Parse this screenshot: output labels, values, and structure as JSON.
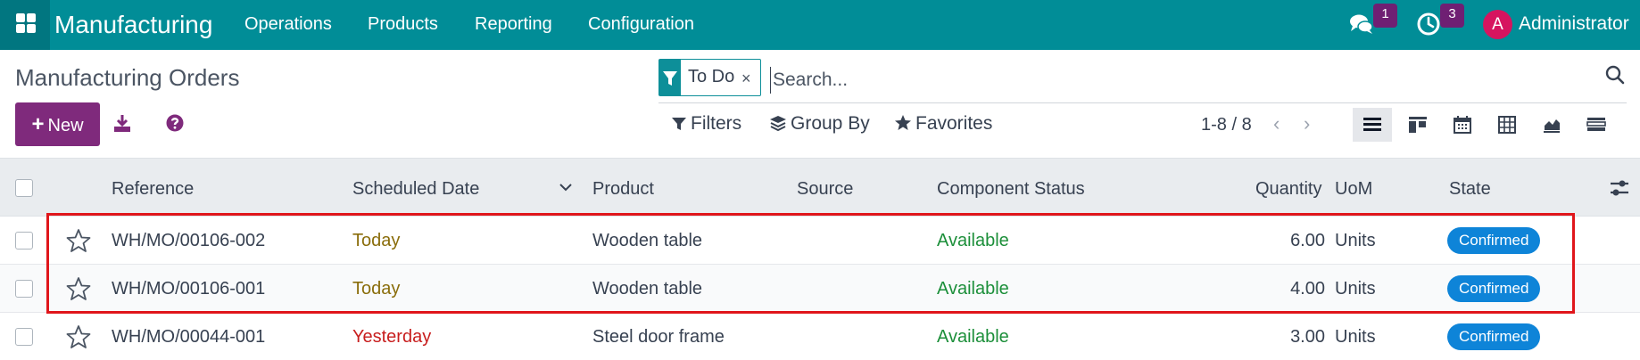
{
  "navbar": {
    "app_name": "Manufacturing",
    "menus": [
      "Operations",
      "Products",
      "Reporting",
      "Configuration"
    ],
    "messages_count": "1",
    "activities_count": "3",
    "user_initial": "A",
    "user_name": "Administrator",
    "icons": [
      "apps-grid-icon",
      "chat-bubbles-icon",
      "clock-icon"
    ]
  },
  "control_panel": {
    "title": "Manufacturing Orders",
    "new_label": "New",
    "icons": [
      "download-icon",
      "help-icon"
    ],
    "search": {
      "facet_label": "To Do",
      "facet_remove": "×",
      "placeholder": "Search..."
    },
    "filters_label": "Filters",
    "group_by_label": "Group By",
    "favorites_label": "Favorites",
    "pager": "1-8 / 8",
    "views": [
      "list-view-icon",
      "kanban-view-icon",
      "calendar-view-icon",
      "pivot-view-icon",
      "graph-view-icon",
      "gantt-view-icon"
    ]
  },
  "list": {
    "columns": [
      "Reference",
      "Scheduled Date",
      "Product",
      "Source",
      "Component Status",
      "Quantity",
      "UoM",
      "State"
    ],
    "rows": [
      {
        "reference": "WH/MO/00106-002",
        "date": "Today",
        "product": "Wooden table",
        "source": "",
        "component_status": "Available",
        "quantity": "6.00",
        "uom": "Units",
        "state": "Confirmed"
      },
      {
        "reference": "WH/MO/00106-001",
        "date": "Today",
        "product": "Wooden table",
        "source": "",
        "component_status": "Available",
        "quantity": "4.00",
        "uom": "Units",
        "state": "Confirmed"
      },
      {
        "reference": "WH/MO/00044-001",
        "date": "Yesterday",
        "product": "Steel door frame",
        "source": "",
        "component_status": "Available",
        "quantity": "3.00",
        "uom": "Units",
        "state": "Confirmed"
      }
    ]
  },
  "colors": {
    "navbar": "#018d97",
    "primary": "#7f2a7c",
    "badge": "#6f1f73",
    "state_confirmed": "#0e84d8",
    "today": "#8a6d0b",
    "late": "#c81e1e",
    "available": "#1c8f3a",
    "highlight": "#e0161b"
  }
}
